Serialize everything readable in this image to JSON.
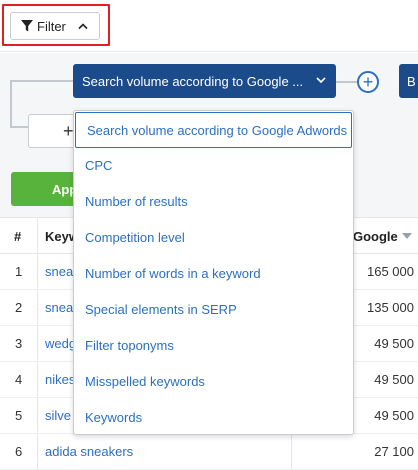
{
  "toolbar": {
    "filter_label": "Filter"
  },
  "filter_panel": {
    "select_label": "Search volume according to Google ...",
    "add_condition_label": "+",
    "right_button_label": "B",
    "add_group_label": "+",
    "apply_label": "App"
  },
  "dropdown": {
    "options": [
      "Search volume according to Google Adwords",
      "CPC",
      "Number of results",
      "Competition level",
      "Number of words in a keyword",
      "Special elements in SERP",
      "Filter toponyms",
      "Misspelled keywords",
      "Keywords"
    ],
    "selected_index": 0
  },
  "table": {
    "headers": {
      "number": "#",
      "keyword": "Keyw",
      "volume": "Google"
    },
    "rows": [
      {
        "num": "1",
        "keyword": "snea",
        "volume": "165 000"
      },
      {
        "num": "2",
        "keyword": "snea",
        "volume": "135 000"
      },
      {
        "num": "3",
        "keyword": "wedg",
        "volume": "49 500"
      },
      {
        "num": "4",
        "keyword": "nikes",
        "volume": "49 500"
      },
      {
        "num": "5",
        "keyword": "silve",
        "volume": "49 500"
      },
      {
        "num": "6",
        "keyword": "adida sneakers",
        "volume": "27 100"
      }
    ]
  },
  "colors": {
    "accent": "#1c4b8c",
    "link": "#2c6fc0",
    "apply": "#58b33c",
    "highlight": "#e02020"
  },
  "icons": {
    "filter": "funnel-icon",
    "toggle": "chevron-up-icon",
    "select": "chevron-down-icon",
    "add": "plus-circle-icon",
    "sort": "sort-down-icon"
  }
}
